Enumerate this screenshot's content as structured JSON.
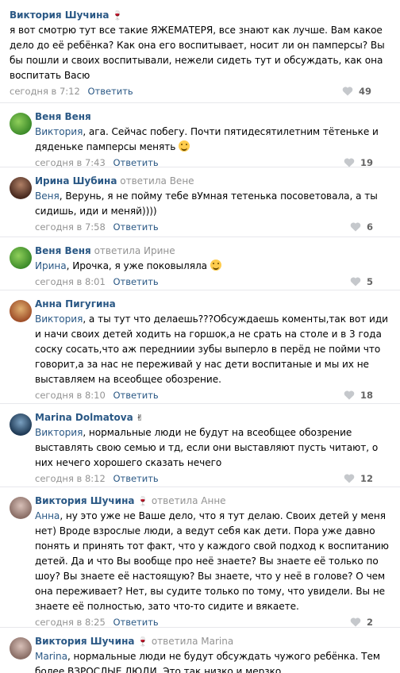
{
  "reply_label": "Ответить",
  "replied_to_prefix": "ответила",
  "colors": {
    "link": "#2a5885",
    "muted": "#939393",
    "divider": "#e7e8ec"
  },
  "comments": [
    {
      "author": "Виктория Шучина",
      "badge_icon": "wine-glass-icon",
      "reply_to": "",
      "addressee": "",
      "text": "я вот смотрю тут все такие ЯЖЕМАТЕРЯ, все знают как лучше. Вам какое дело до её ребёнка? Как она его воспитывает, носит ли он памперсы? Вы бы пошли и своих воспитывали, нежели сидеть тут и обсуждать, как она воспитать Васю",
      "time": "сегодня в 7:12",
      "likes": "49"
    },
    {
      "author": "Веня Веня",
      "reply_to": "",
      "addressee": "Виктория",
      "text": ", ага. Сейчас побегу. Почти пятидесятилетним тётеньке и дяденьке памперсы менять",
      "emoji": "smirk-emoji-icon",
      "time": "сегодня в 7:43",
      "likes": "19"
    },
    {
      "author": "Ирина Шубина",
      "reply_to": "Вене",
      "addressee": "Веня",
      "text": ", Верунь, я не пойму тебе вУмная тетенька посоветовала, а ты сидишь, иди и меняй))))",
      "time": "сегодня в 7:58",
      "likes": "6"
    },
    {
      "author": "Веня Веня",
      "reply_to": "Ирине",
      "addressee": "Ирина",
      "text": ", Ирочка, я уже поковыляла",
      "emoji": "laughing-emoji-icon",
      "time": "сегодня в 8:01",
      "likes": "5"
    },
    {
      "author": "Анна Пигугина",
      "reply_to": "",
      "addressee": "Виктория",
      "text": ", а ты тут что делаешь???Обсуждаешь коменты,так вот иди и начи своих детей ходить на горшок,а не срать на столе и в 3 года соску сосать,что аж передниии зубы выперло в перёд не пойми что говорит,а за нас не переживай у нас дети воспитаные и мы их не выставляем на всеобщее обозрение.",
      "time": "сегодня в 8:10",
      "likes": "18"
    },
    {
      "author": "Marina Dolmatova",
      "badge_icon": "victory-hand-icon",
      "reply_to": "",
      "addressee": "Виктория",
      "text": ", нормальные люди не будут на всеобщее обозрение выставлять свою семью и тд, если они выставляют пусть читают, о них нечего хорошего сказать нечего",
      "time": "сегодня в 8:12",
      "likes": "12"
    },
    {
      "author": "Виктория Шучина",
      "badge_icon": "wine-glass-icon",
      "reply_to": "Анне",
      "addressee": "Анна",
      "text": ", ну это уже не Ваше дело, что я тут делаю. Своих детей у меня нет) Вроде взрослые люди, а ведут себя как дети. Пора уже давно понять и принять тот факт, что у каждого свой подход к воспитанию детей. Да и что Вы вообще про неё знаете? Вы знаете её только по шоу? Вы знаете её настоящую? Вы знаете, что у неё в голове? О чем она переживает? Нет, вы судите только по тому, что увидели. Вы не знаете её полностью, зато что-то сидите и вякаете.",
      "time": "сегодня в 8:25",
      "likes": "2"
    },
    {
      "author": "Виктория Шучина",
      "badge_icon": "wine-glass-icon",
      "reply_to": "Marina",
      "addressee": "Marina",
      "text": ", нормальные люди не будут обсуждать чужого ребёнка. Тем более ВЗРОСЛЫЕ ЛЮДИ. Это так низко и мерзко",
      "time": "",
      "likes": ""
    }
  ]
}
